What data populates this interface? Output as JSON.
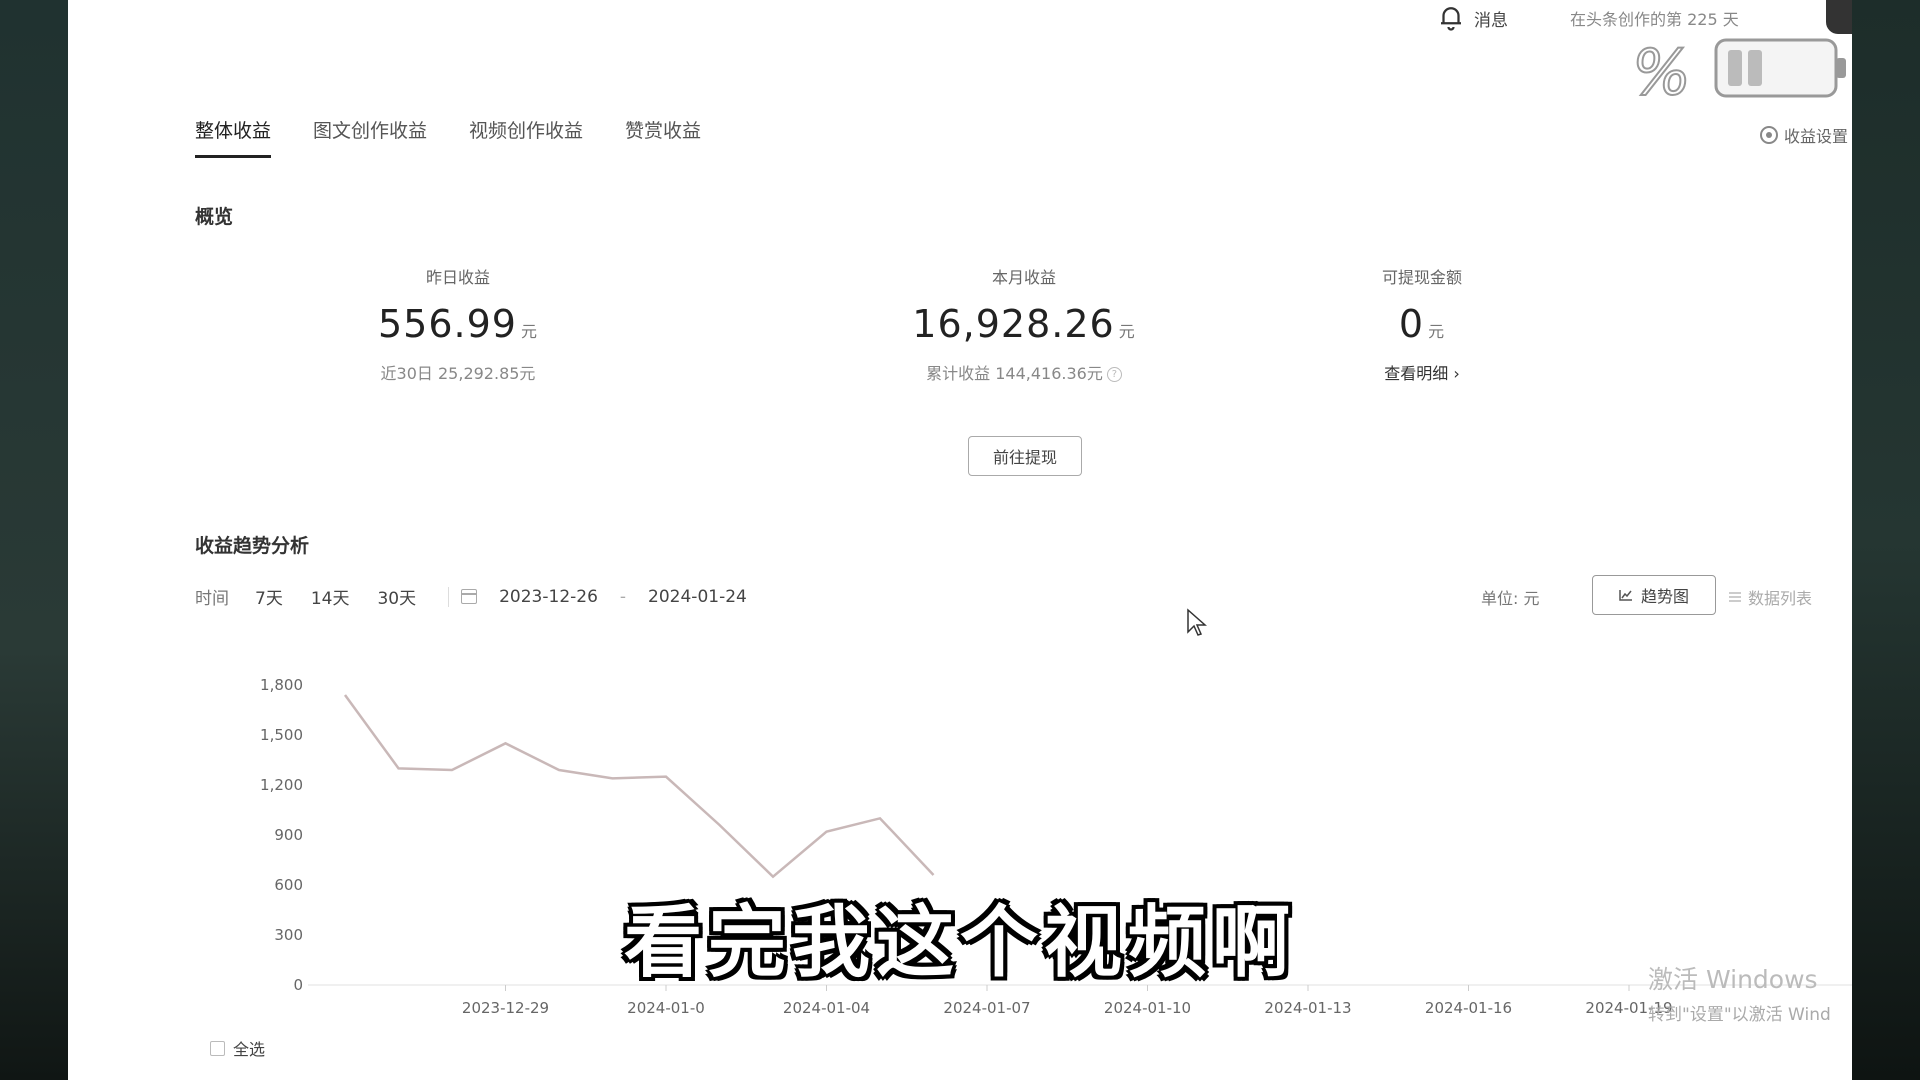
{
  "header": {
    "messages_label": "消息",
    "creation_days_text": "在头条创作的第 225 天"
  },
  "tabs": [
    {
      "label": "整体收益",
      "active": true
    },
    {
      "label": "图文创作收益",
      "active": false
    },
    {
      "label": "视频创作收益",
      "active": false
    },
    {
      "label": "赞赏收益",
      "active": false
    }
  ],
  "settings_label": "收益设置",
  "overview": {
    "title": "概览",
    "yesterday": {
      "label": "昨日收益",
      "value": "556.99",
      "unit": "元",
      "sub": "近30日 25,292.85元"
    },
    "month": {
      "label": "本月收益",
      "value": "16,928.26",
      "unit": "元",
      "sub": "累计收益 144,416.36元"
    },
    "withdrawable": {
      "label": "可提现金额",
      "value": "0",
      "unit": "元",
      "link": "查看明细 ›"
    },
    "withdraw_button": "前往提现"
  },
  "trend": {
    "title": "收益趋势分析",
    "time_label": "时间",
    "ranges": [
      "7天",
      "14天",
      "30天"
    ],
    "date_start": "2023-12-26",
    "date_sep": "-",
    "date_end": "2024-01-24",
    "unit_label": "单位: 元",
    "view_trend": "趋势图",
    "view_list": "数据列表",
    "select_all": "全选"
  },
  "chart_data": {
    "type": "line",
    "yticks": [
      "1,800",
      "1,500",
      "1,200",
      "900",
      "600",
      "300",
      "0"
    ],
    "ylim": [
      0,
      1800
    ],
    "xtick_labels": [
      "2023-12-29",
      "2024-01-0",
      "2024-01-04",
      "2024-01-07",
      "2024-01-10",
      "2024-01-13",
      "2024-01-16",
      "2024-01-19"
    ],
    "series": [
      {
        "values": [
          1740,
          1300,
          1290,
          1450,
          1290,
          1240,
          1250,
          960,
          650,
          920,
          1000,
          660
        ]
      }
    ]
  },
  "subtitle": "看完我这个视频啊",
  "watermark": {
    "title": "激活 Windows",
    "sub": "转到\"设置\"以激活 Wind"
  },
  "colors": {
    "line": "#c9b8b8",
    "accent": "#222222"
  }
}
